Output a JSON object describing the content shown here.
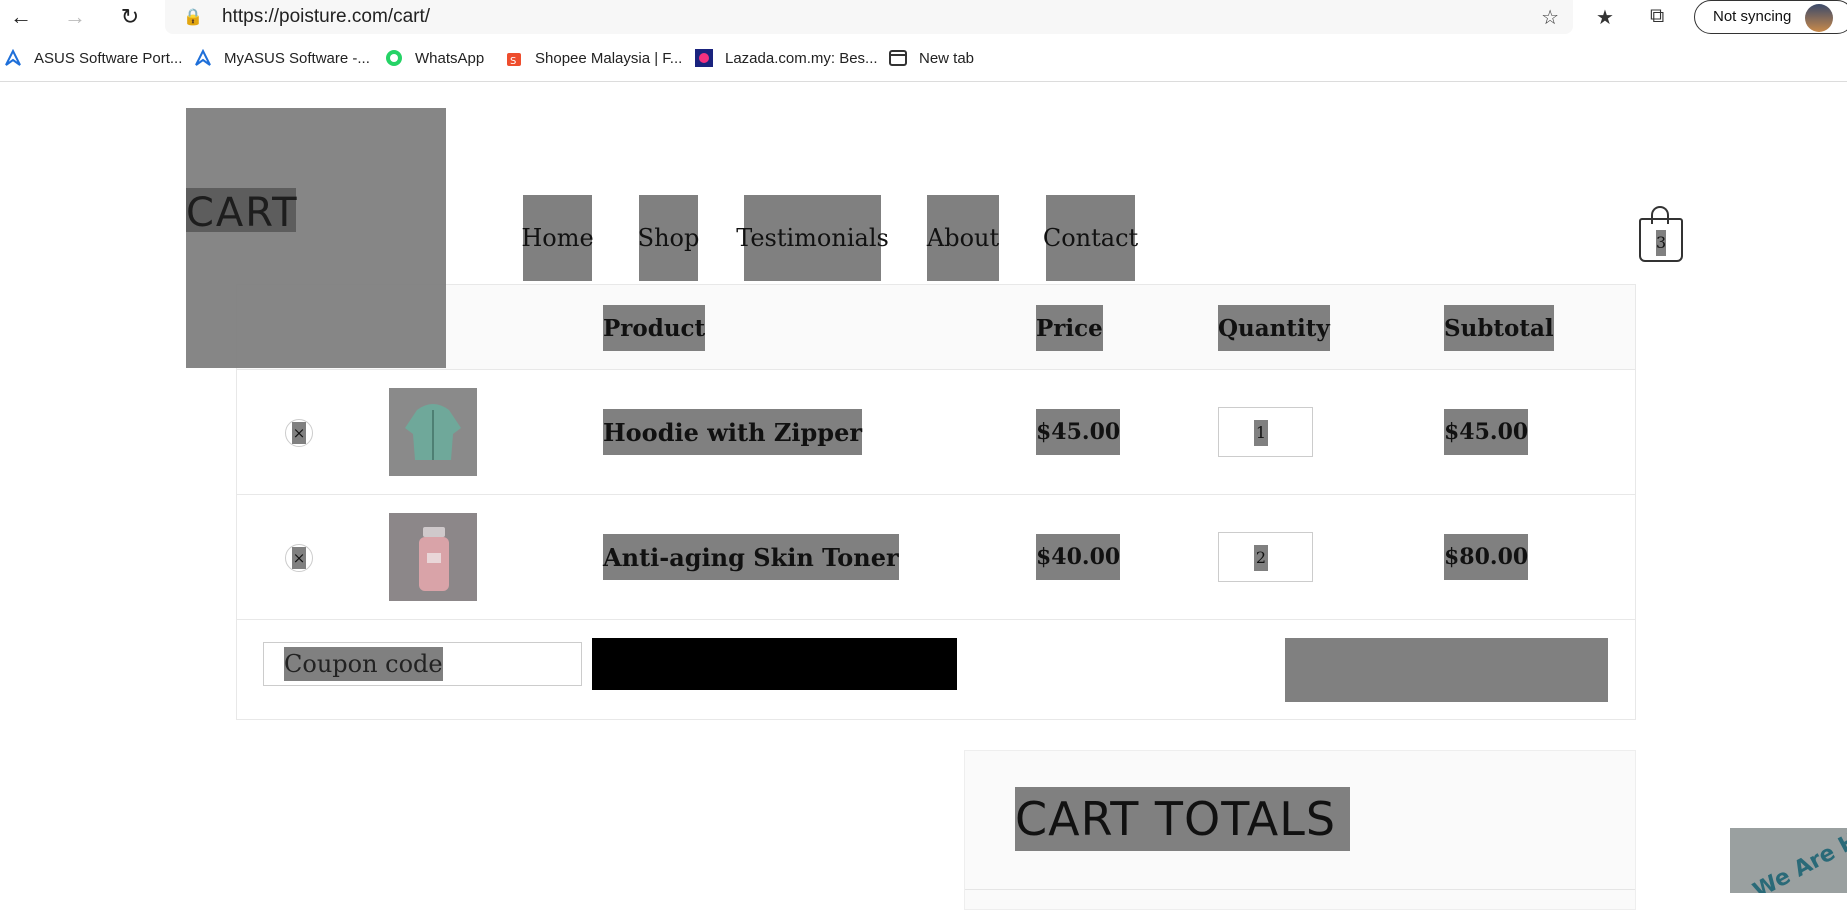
{
  "browser": {
    "url": "https://poisture.com/cart/",
    "sync_label": "Not syncing",
    "icons": [
      "back-icon",
      "forward-icon",
      "refresh-icon",
      "lock-icon",
      "favorite-add-icon",
      "favorites-icon",
      "collections-icon"
    ],
    "bookmarks": [
      {
        "label": "ASUS Software Port...",
        "icon": "asus-icon",
        "color": "#1e6fd9"
      },
      {
        "label": "MyASUS Software -...",
        "icon": "asus-icon",
        "color": "#1e6fd9"
      },
      {
        "label": "WhatsApp",
        "icon": "whatsapp-icon",
        "color": "#25d366"
      },
      {
        "label": "Shopee Malaysia | F...",
        "icon": "shopee-icon",
        "color": "#ee4d2d"
      },
      {
        "label": "Lazada.com.my: Bes...",
        "icon": "lazada-icon",
        "color": "#1a237e"
      },
      {
        "label": "New tab",
        "icon": "newtab-icon",
        "color": "#333333"
      }
    ]
  },
  "site": {
    "logo_text": "CART",
    "menu": [
      "Home",
      "Shop",
      "Testimonials",
      "About",
      "Contact"
    ],
    "cart_count": "3"
  },
  "cart": {
    "headers": {
      "product": "Product",
      "price": "Price",
      "quantity": "Quantity",
      "subtotal": "Subtotal"
    },
    "items": [
      {
        "remove": "×",
        "name": "Hoodie with Zipper",
        "price": "$45.00",
        "quantity": "1",
        "subtotal": "$45.00",
        "thumb_color": "#6fa89a"
      },
      {
        "remove": "×",
        "name": "Anti-aging Skin Toner",
        "price": "$40.00",
        "quantity": "2",
        "subtotal": "$80.00",
        "thumb_color": "#d9a3a8"
      }
    ],
    "coupon_placeholder": "Coupon code"
  },
  "totals": {
    "title": "CART TOTALS"
  },
  "help_badge": "We Are Here"
}
